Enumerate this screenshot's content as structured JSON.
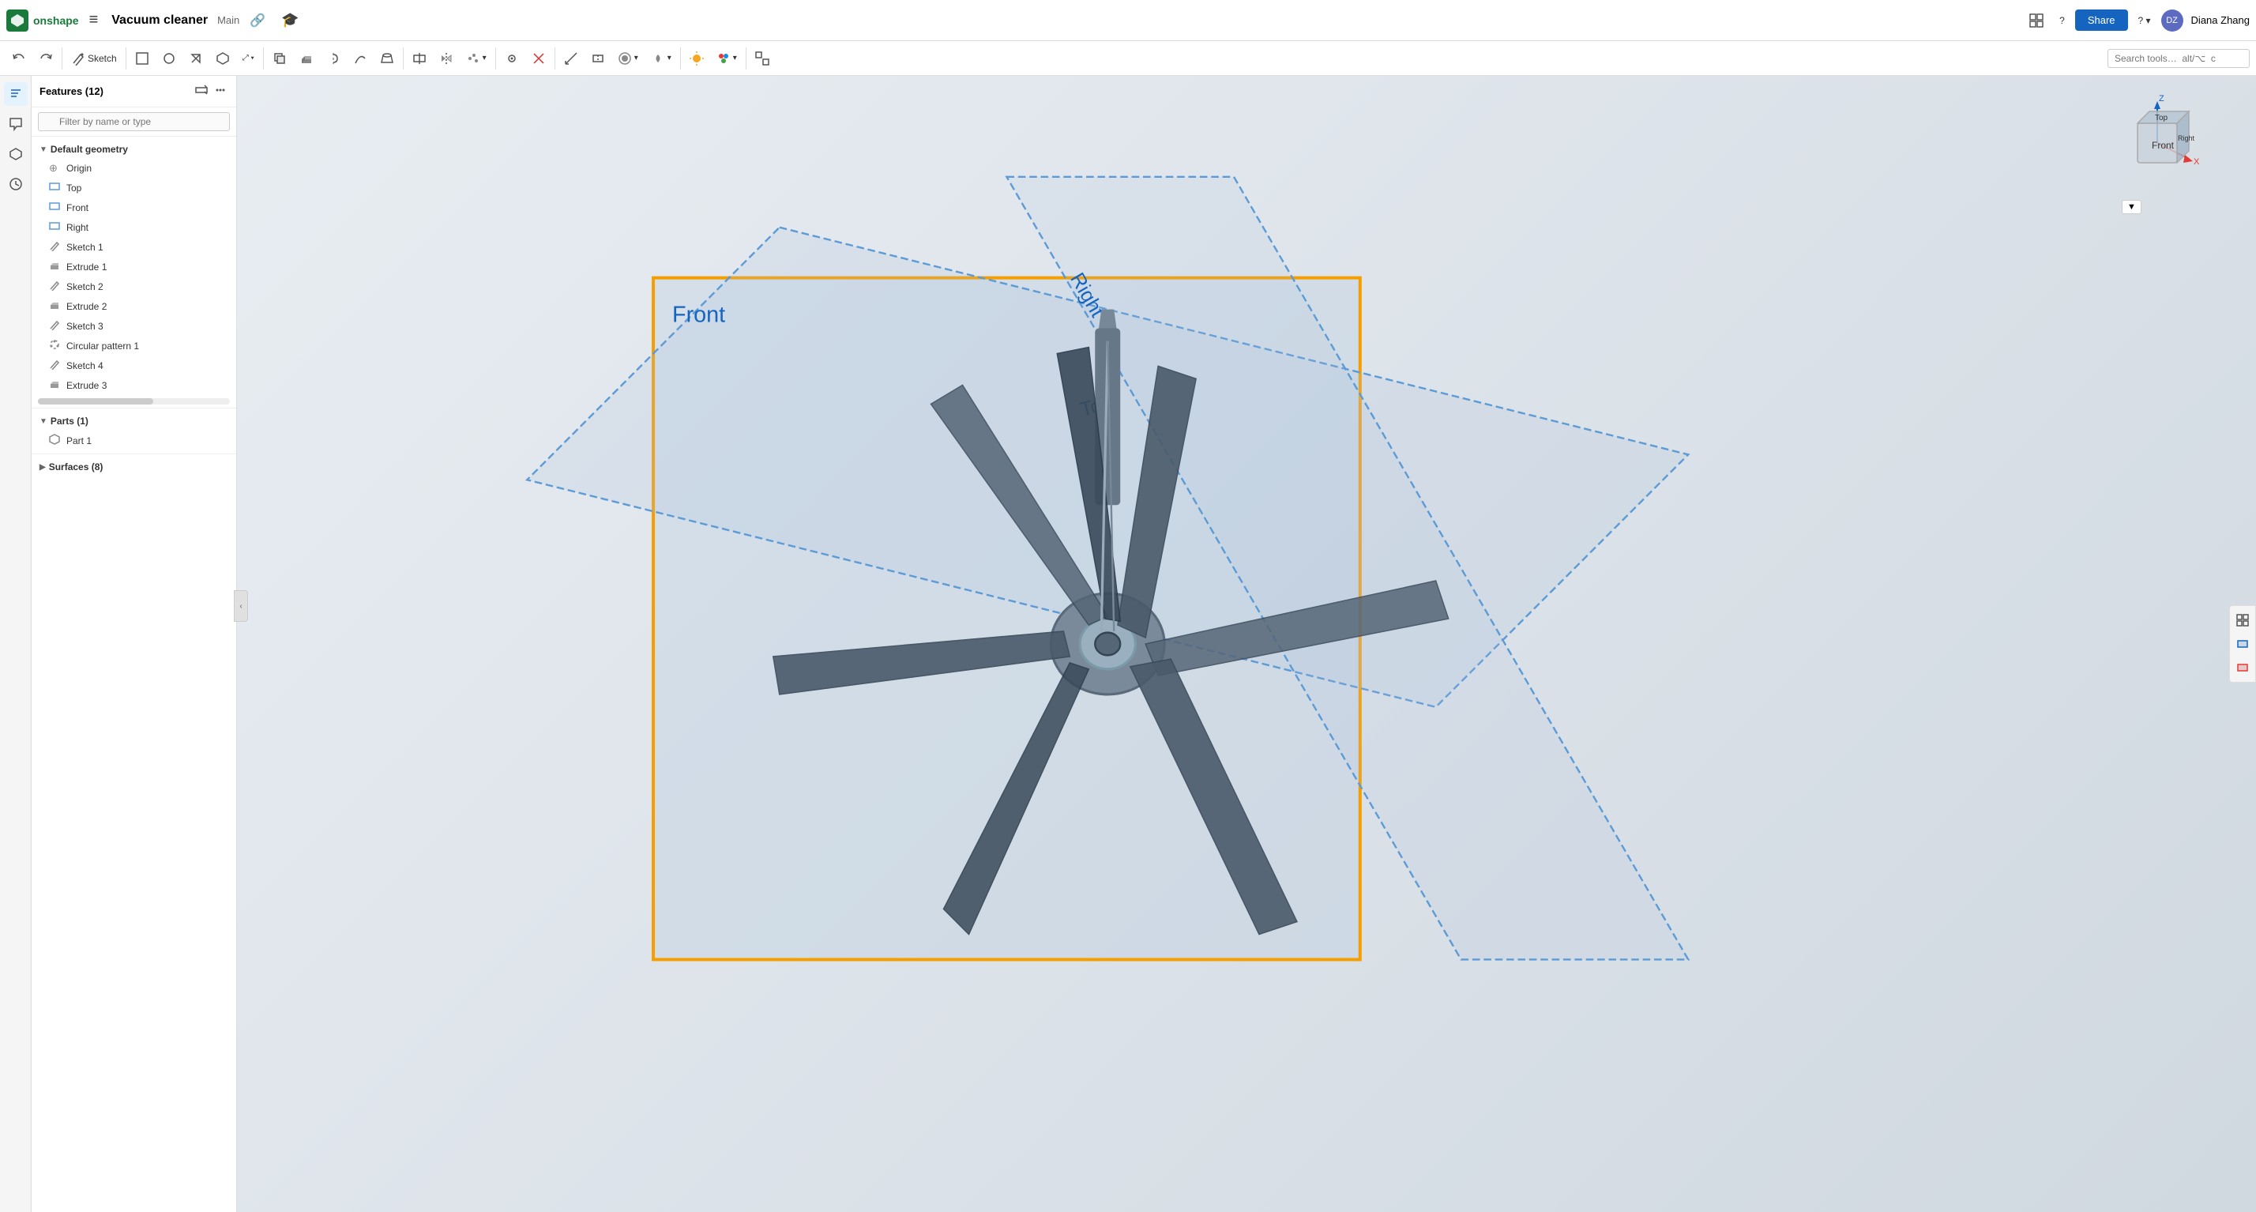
{
  "app": {
    "logo_text": "onshape",
    "hamburger": "≡",
    "doc_title": "Vacuum cleaner",
    "doc_branch": "Main",
    "link_icon": "🔗",
    "grad_icon": "🎓",
    "share_label": "Share",
    "help_label": "?",
    "user_name": "Diana Zhang",
    "user_initials": "DZ"
  },
  "toolbar": {
    "undo_label": "↩",
    "redo_label": "↪",
    "sketch_label": "Sketch",
    "search_placeholder": "Search tools…  alt/⌥  c",
    "buttons": [
      {
        "name": "undo",
        "icon": "↩",
        "label": ""
      },
      {
        "name": "redo",
        "icon": "↪",
        "label": ""
      },
      {
        "name": "sketch",
        "icon": "✏",
        "label": "Sketch"
      },
      {
        "name": "new-part",
        "icon": "☐",
        "label": ""
      },
      {
        "name": "fillet",
        "icon": "◌",
        "label": ""
      },
      {
        "name": "chamfer",
        "icon": "◇",
        "label": ""
      },
      {
        "name": "shell",
        "icon": "⬡",
        "label": ""
      },
      {
        "name": "transform",
        "icon": "⤢",
        "label": ""
      },
      {
        "name": "boolean",
        "icon": "⊕",
        "label": ""
      },
      {
        "name": "extrude",
        "icon": "⬛",
        "label": ""
      },
      {
        "name": "revolve",
        "icon": "⟳",
        "label": ""
      },
      {
        "name": "sweep",
        "icon": "〜",
        "label": ""
      },
      {
        "name": "loft",
        "icon": "◻",
        "label": ""
      },
      {
        "name": "helix",
        "icon": "⥁",
        "label": ""
      },
      {
        "name": "split",
        "icon": "⊓",
        "label": ""
      },
      {
        "name": "mirror",
        "icon": "⇔",
        "label": ""
      },
      {
        "name": "pattern",
        "icon": "⊞",
        "label": ""
      },
      {
        "name": "mate",
        "icon": "⊙",
        "label": ""
      },
      {
        "name": "delete",
        "icon": "✕",
        "label": ""
      },
      {
        "name": "measure",
        "icon": "📏",
        "label": ""
      },
      {
        "name": "section",
        "icon": "⊡",
        "label": ""
      },
      {
        "name": "display",
        "icon": "◉",
        "label": ""
      },
      {
        "name": "view",
        "icon": "👁",
        "label": ""
      },
      {
        "name": "render",
        "icon": "💡",
        "label": ""
      },
      {
        "name": "appearance",
        "icon": "🎨",
        "label": ""
      },
      {
        "name": "zoom-fit",
        "icon": "⊞",
        "label": ""
      }
    ]
  },
  "feature_panel": {
    "title": "Features (12)",
    "filter_placeholder": "Filter by name or type",
    "sections": {
      "default_geometry": {
        "label": "Default geometry",
        "items": [
          {
            "name": "Origin",
            "type": "origin",
            "icon": "⊕"
          },
          {
            "name": "Top",
            "type": "plane",
            "icon": "▭"
          },
          {
            "name": "Front",
            "type": "plane",
            "icon": "▭"
          },
          {
            "name": "Right",
            "type": "plane",
            "icon": "▭"
          }
        ]
      },
      "features": {
        "items": [
          {
            "name": "Sketch 1",
            "type": "sketch",
            "icon": "✏"
          },
          {
            "name": "Extrude 1",
            "type": "extrude",
            "icon": "⬛"
          },
          {
            "name": "Sketch 2",
            "type": "sketch",
            "icon": "✏"
          },
          {
            "name": "Extrude 2",
            "type": "extrude",
            "icon": "⬛"
          },
          {
            "name": "Sketch 3",
            "type": "sketch",
            "icon": "✏"
          },
          {
            "name": "Circular pattern 1",
            "type": "pattern",
            "icon": "⊙"
          },
          {
            "name": "Sketch 4",
            "type": "sketch",
            "icon": "✏"
          },
          {
            "name": "Extrude 3",
            "type": "extrude",
            "icon": "⬛"
          }
        ]
      },
      "parts": {
        "label": "Parts (1)",
        "items": [
          {
            "name": "Part 1",
            "type": "part",
            "icon": "⬡"
          }
        ]
      },
      "surfaces": {
        "label": "Surfaces (8)",
        "expanded": false
      }
    }
  },
  "viewport": {
    "front_label": "Front",
    "top_label": "Top",
    "right_label": "Right",
    "orient_faces": [
      "Front",
      "Top",
      "Right"
    ]
  },
  "colors": {
    "accent": "#1565c0",
    "plane_front": "#f59e00",
    "plane_blue": "#5c9bd6",
    "brand_green": "#1a7a3c",
    "bg_viewport": "#dce3ea"
  }
}
